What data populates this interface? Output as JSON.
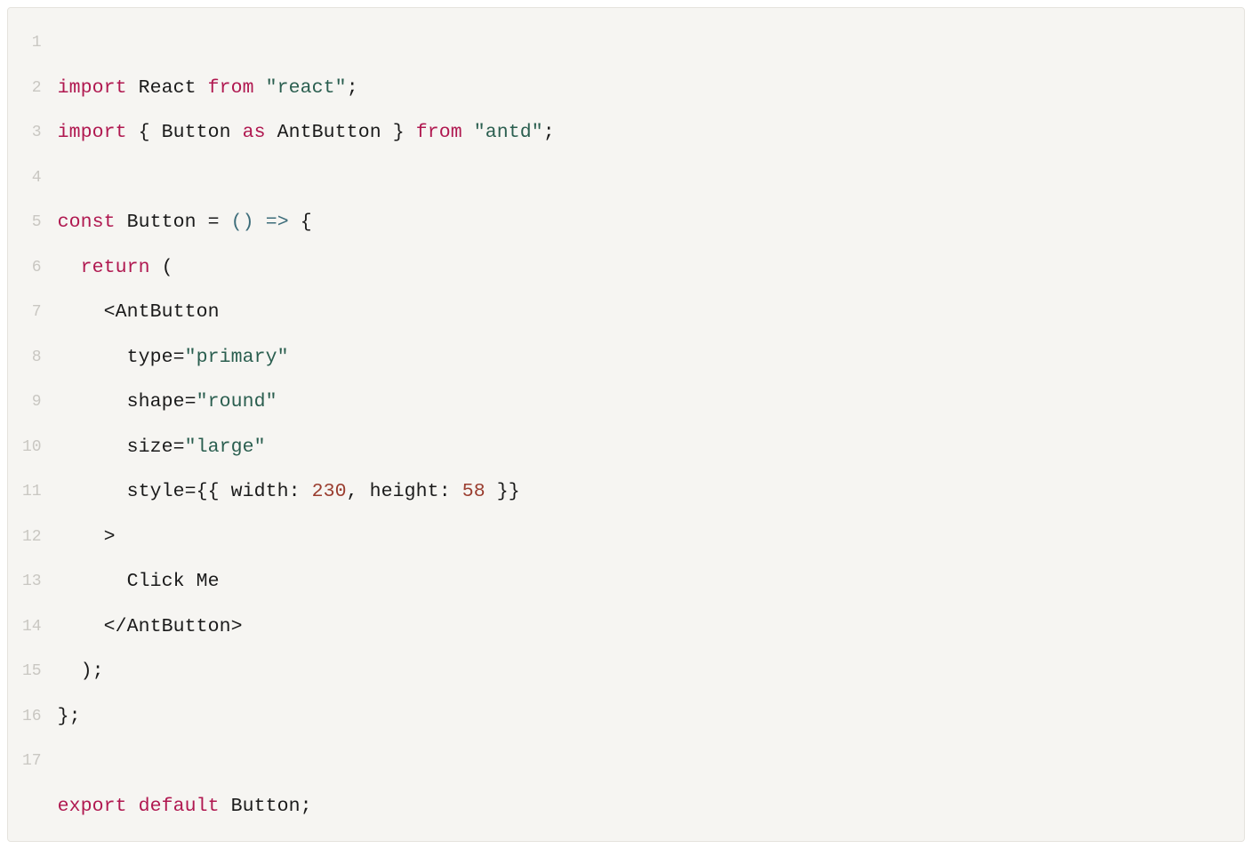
{
  "lineNumbers": [
    "1",
    "2",
    "3",
    "4",
    "5",
    "6",
    "7",
    "8",
    "9",
    "10",
    "11",
    "12",
    "13",
    "14",
    "15",
    "16",
    "17"
  ],
  "code": {
    "l1": {
      "t1": "import",
      "t2": " React ",
      "t3": "from",
      "t4": " ",
      "t5": "\"react\"",
      "t6": ";"
    },
    "l2": {
      "t1": "import",
      "t2": " { Button ",
      "t3": "as",
      "t4": " AntButton } ",
      "t5": "from",
      "t6": " ",
      "t7": "\"antd\"",
      "t8": ";"
    },
    "l3": {
      "t1": ""
    },
    "l4": {
      "t1": "const",
      "t2": " Button = ",
      "t3": "()",
      "t4": " ",
      "t5": "=>",
      "t6": " {"
    },
    "l5": {
      "t1": "  ",
      "t2": "return",
      "t3": " ("
    },
    "l6": {
      "t1": "    <AntButton"
    },
    "l7": {
      "t1": "      type=",
      "t2": "\"primary\""
    },
    "l8": {
      "t1": "      shape=",
      "t2": "\"round\""
    },
    "l9": {
      "t1": "      size=",
      "t2": "\"large\""
    },
    "l10": {
      "t1": "      style={{ width: ",
      "t2": "230",
      "t3": ", height: ",
      "t4": "58",
      "t5": " }}"
    },
    "l11": {
      "t1": "    >"
    },
    "l12": {
      "t1": "      Click Me"
    },
    "l13": {
      "t1": "    </AntButton>"
    },
    "l14": {
      "t1": "  );"
    },
    "l15": {
      "t1": "};"
    },
    "l16": {
      "t1": ""
    },
    "l17": {
      "t1": "export",
      "t2": " ",
      "t3": "default",
      "t4": " Button;"
    }
  }
}
